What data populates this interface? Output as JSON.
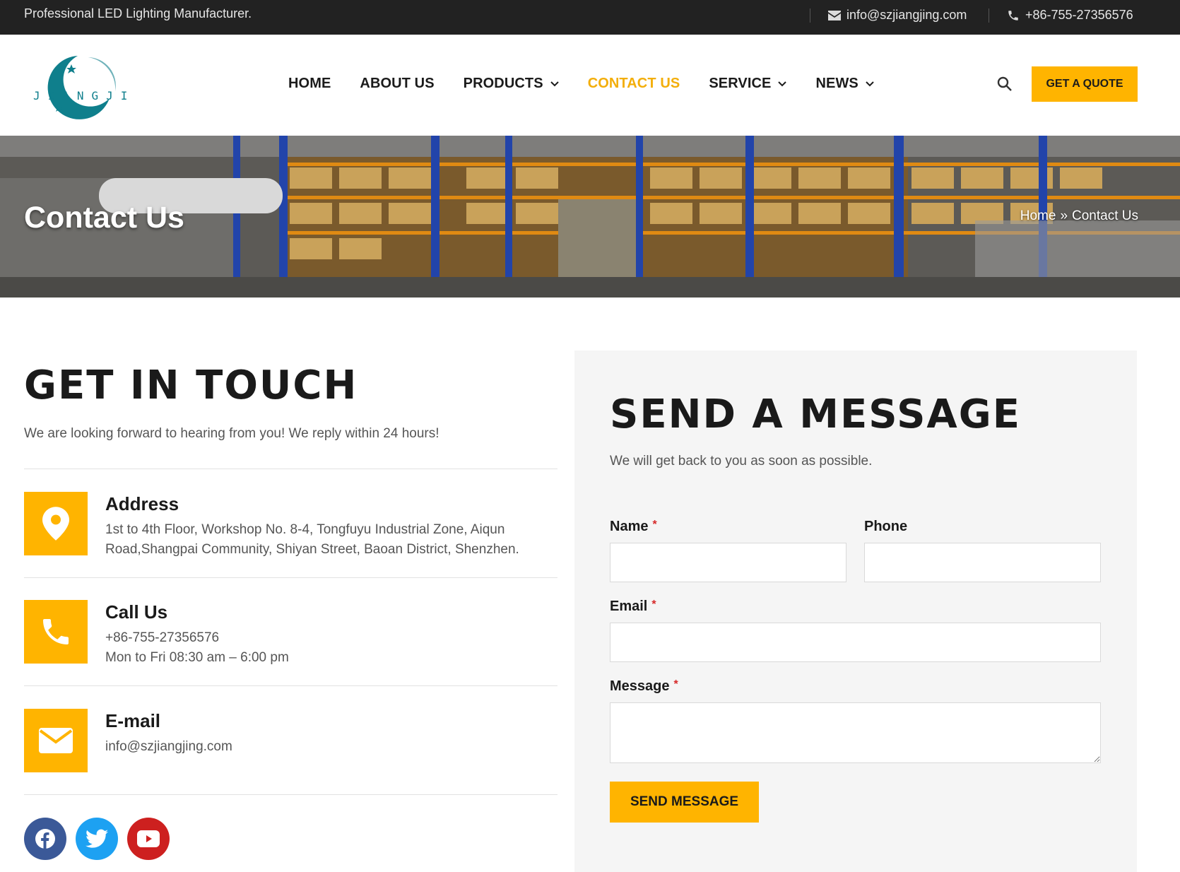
{
  "topbar": {
    "tagline": "Professional LED Lighting Manufacturer.",
    "email": "info@szjiangjing.com",
    "phone": "+86-755-27356576"
  },
  "header": {
    "logo_text": "JIANGJING",
    "nav": [
      {
        "label": "HOME",
        "dropdown": false,
        "active": false
      },
      {
        "label": "ABOUT US",
        "dropdown": false,
        "active": false
      },
      {
        "label": "PRODUCTS",
        "dropdown": true,
        "active": false
      },
      {
        "label": "CONTACT US",
        "dropdown": false,
        "active": true
      },
      {
        "label": "SERVICE",
        "dropdown": true,
        "active": false
      },
      {
        "label": "NEWS",
        "dropdown": true,
        "active": false
      }
    ],
    "quote_label": "GET A QUOTE"
  },
  "banner": {
    "title": "Contact Us",
    "breadcrumb": [
      "Home",
      "»",
      "Contact Us"
    ]
  },
  "touch": {
    "heading": "GET IN TOUCH",
    "intro": "We are looking forward to hearing from you! We reply within 24 hours!",
    "items": [
      {
        "title": "Address",
        "icon": "map-pin-icon",
        "lines": [
          "1st to 4th Floor, Workshop No. 8-4, Tongfuyu Industrial Zone, Aiqun Road,Shangpai Community, Shiyan Street, Baoan District, Shenzhen."
        ]
      },
      {
        "title": "Call Us",
        "icon": "phone-icon",
        "lines": [
          "+86-755-27356576",
          "Mon to Fri 08:30 am – 6:00 pm"
        ]
      },
      {
        "title": "E-mail",
        "icon": "envelope-icon",
        "lines": [
          "info@szjiangjing.com"
        ]
      }
    ]
  },
  "socials": [
    {
      "name": "facebook-icon",
      "color": "#3b5998"
    },
    {
      "name": "twitter-icon",
      "color": "#1da1f2"
    },
    {
      "name": "youtube-icon",
      "color": "#cd201f"
    }
  ],
  "form": {
    "heading": "SEND A MESSAGE",
    "sub": "We will get back to you as soon as possible.",
    "name_label": "Name",
    "phone_label": "Phone",
    "email_label": "Email",
    "message_label": "Message",
    "required_mark": "*",
    "name_value": "",
    "phone_value": "",
    "email_value": "",
    "message_value": "",
    "submit_label": "SEND MESSAGE"
  },
  "colors": {
    "accent": "#ffb400",
    "active_nav": "#f3ae0a",
    "topbar_bg": "#222222",
    "logo_teal": "#0f7f8c"
  }
}
